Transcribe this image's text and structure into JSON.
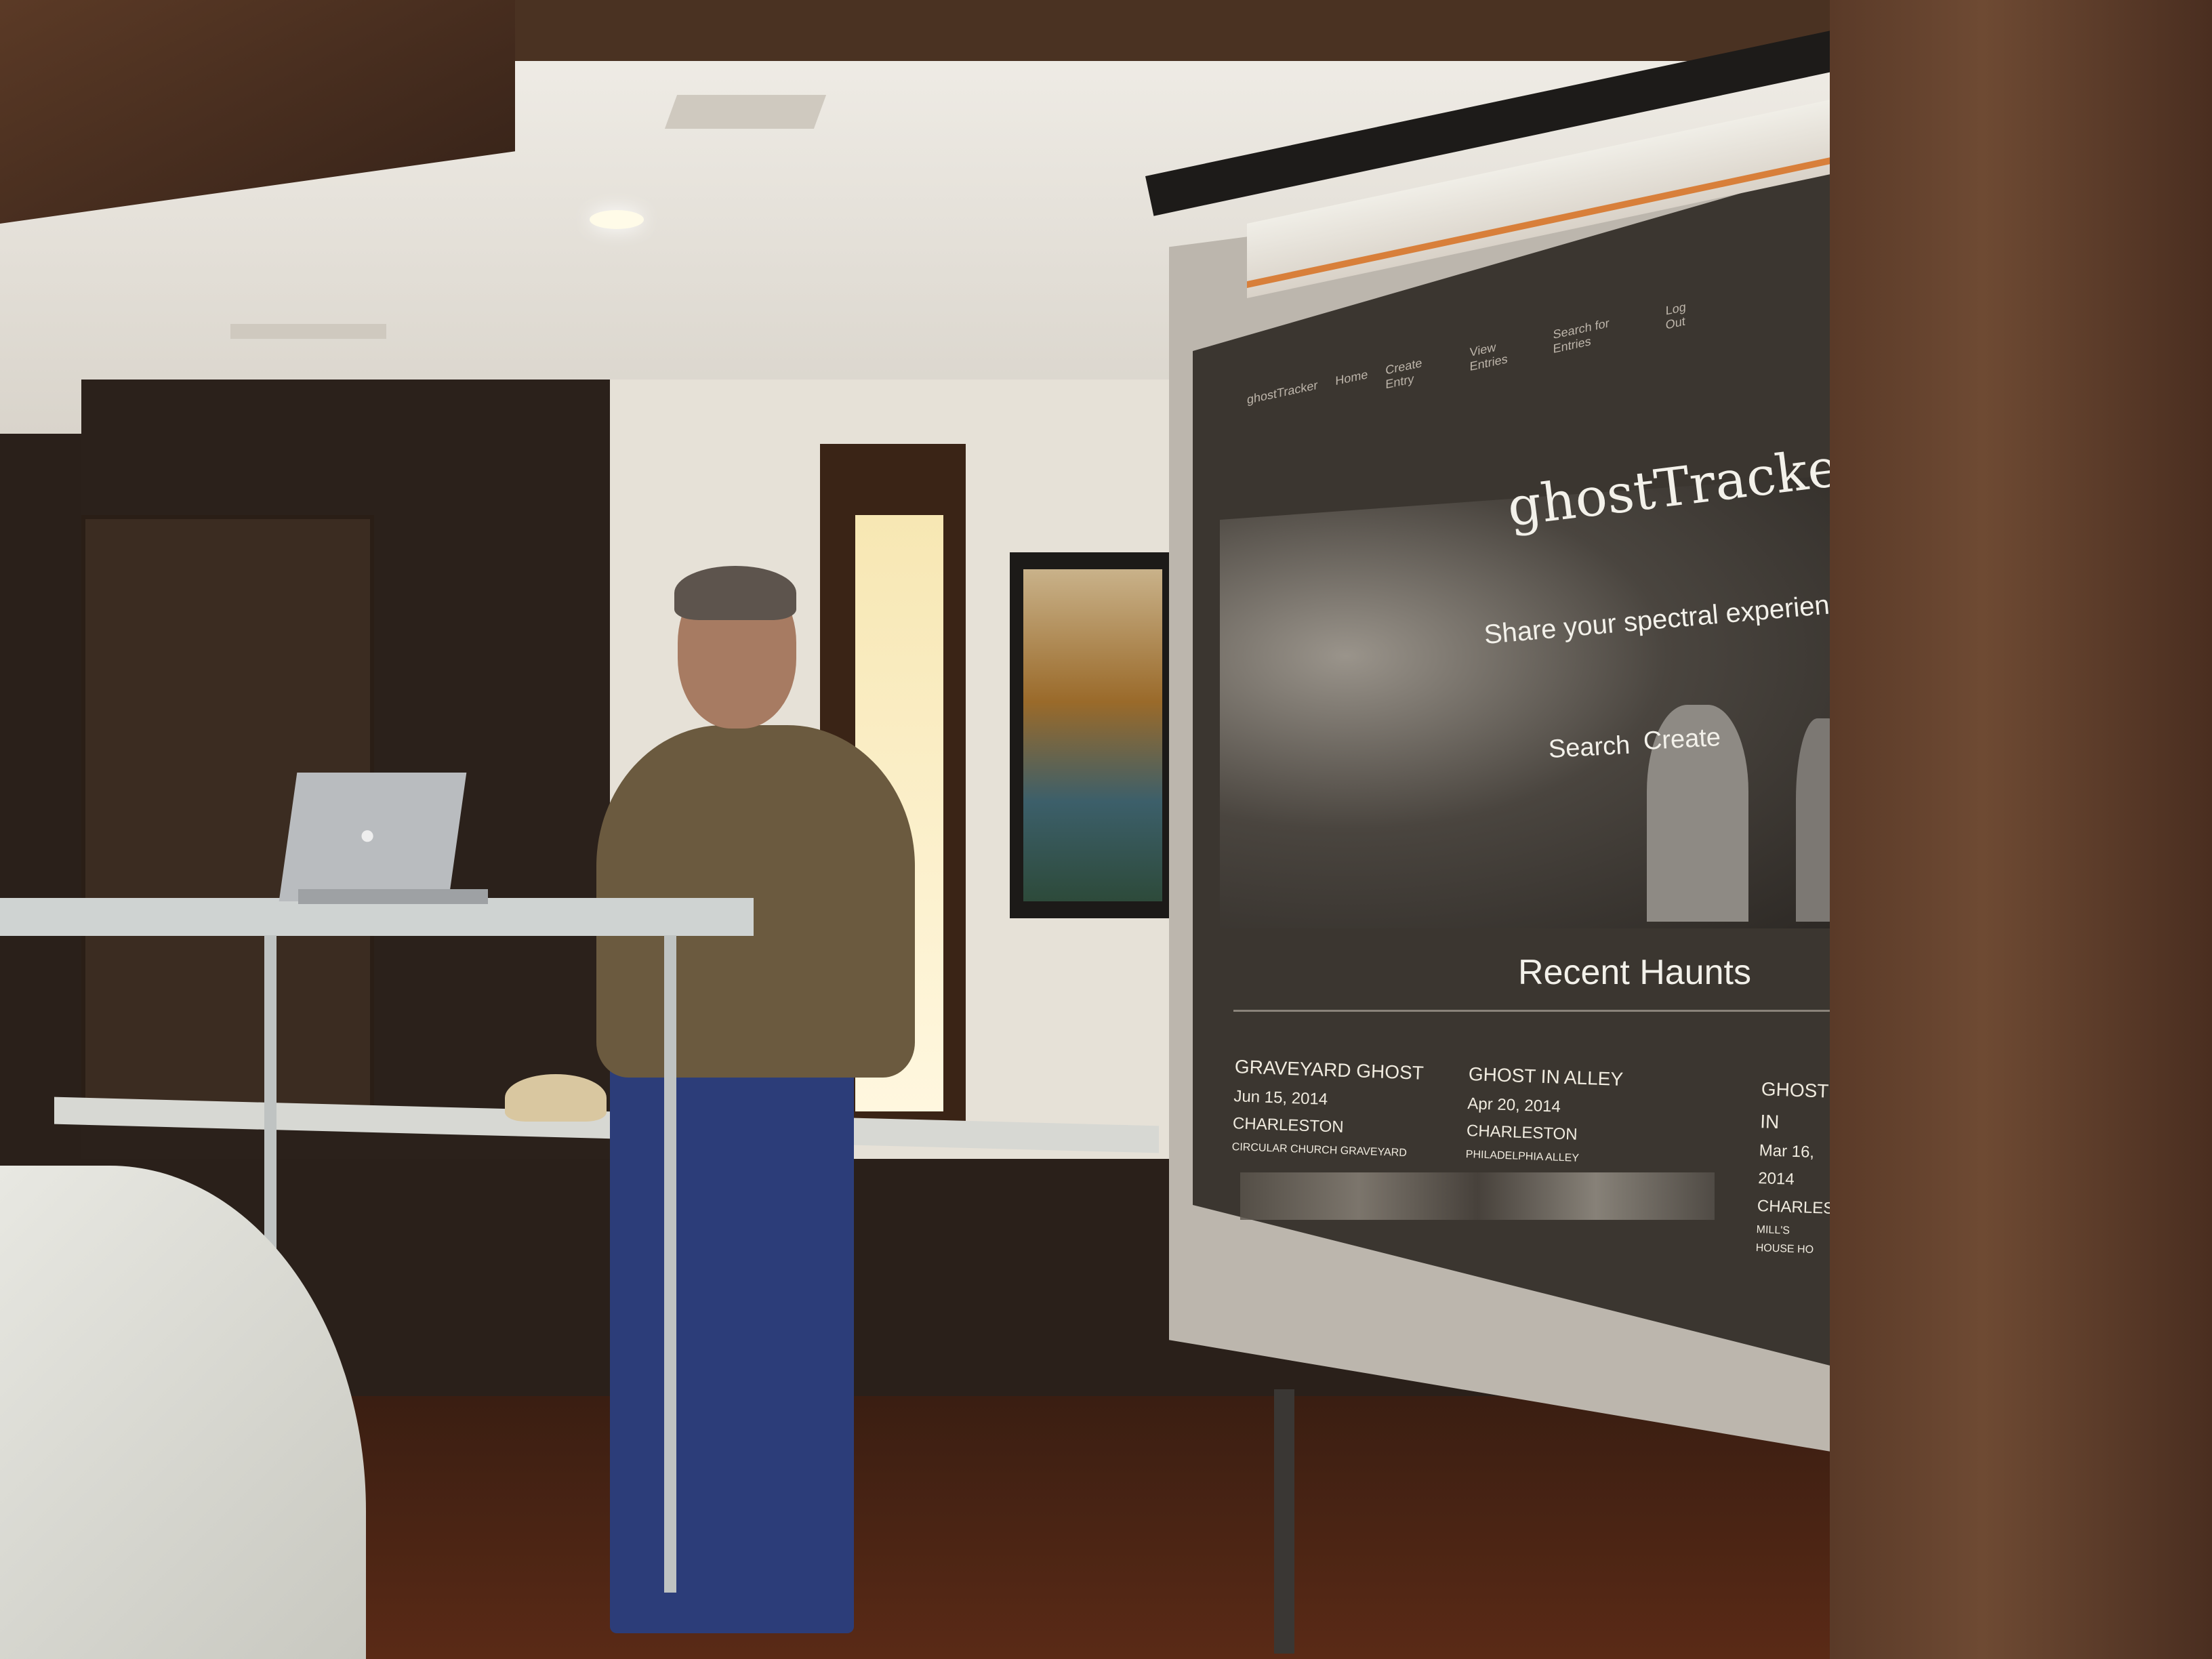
{
  "scene": {
    "description": "",
    "colors": {
      "projection_bg": "#3b3630",
      "text": "#f3f1ea",
      "accent": "#d87f3a"
    }
  },
  "projected_site": {
    "nav": [
      "ghostTracker",
      "Home",
      "Create Entry",
      "View Entries",
      "Search for Entries",
      "Log Out"
    ],
    "title": "ghostTracker",
    "tagline": "Share your spectral experience.",
    "buttons": {
      "search": "Search",
      "create": "Create"
    },
    "recent": {
      "heading": "Recent Haunts",
      "items": [
        {
          "title": "GRAVEYARD GHOST",
          "date": "Jun 15, 2014",
          "city": "CHARLESTON",
          "place": "CIRCULAR CHURCH GRAVEYARD"
        },
        {
          "title": "GHOST IN ALLEY",
          "date": "Apr 20, 2014",
          "city": "CHARLESTON",
          "place": "PHILADELPHIA ALLEY"
        },
        {
          "title": "GHOST IN",
          "date": "Mar 16, 2014",
          "city": "CHARLESTON",
          "place": "MILL'S HOUSE HO"
        }
      ]
    }
  }
}
